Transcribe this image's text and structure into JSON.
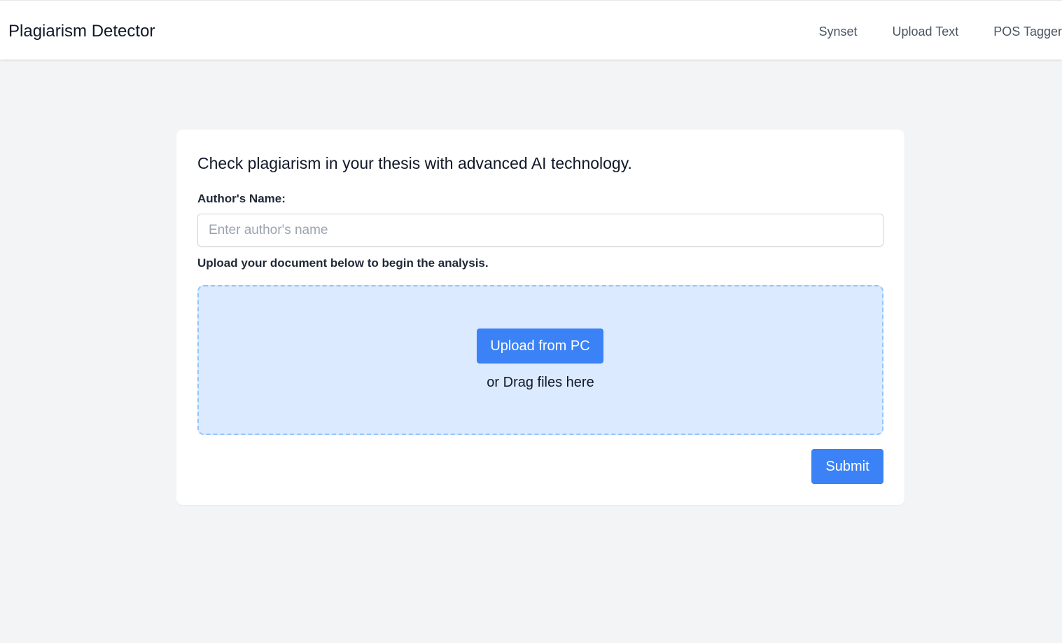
{
  "navbar": {
    "brand": "Plagiarism Detector",
    "links": [
      {
        "label": "Synset"
      },
      {
        "label": "Upload Text"
      },
      {
        "label": "POS Tagger"
      }
    ]
  },
  "main": {
    "headline": "Check plagiarism in your thesis with advanced AI technology.",
    "author_label": "Author's Name:",
    "author_input": {
      "value": "",
      "placeholder": "Enter author's name"
    },
    "upload_label": "Upload your document below to begin the analysis.",
    "dropzone": {
      "upload_button": "Upload from PC",
      "drag_text": "or Drag files here"
    },
    "submit_button": "Submit"
  },
  "colors": {
    "accent": "#3b82f6",
    "dropzone_bg": "#dbeafe",
    "dropzone_border": "#93c5fd",
    "page_bg": "#f3f4f6"
  }
}
